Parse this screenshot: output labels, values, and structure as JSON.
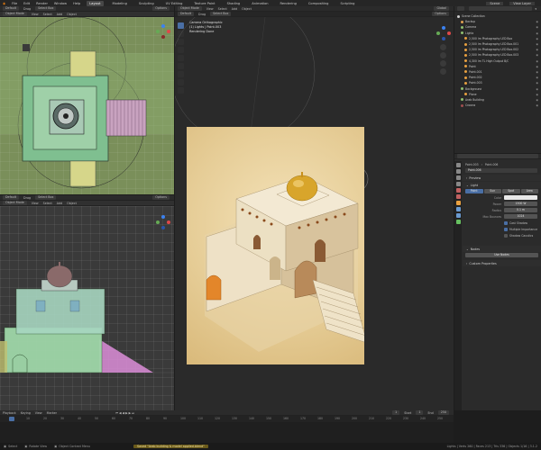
{
  "menubar": {
    "menus": [
      "File",
      "Edit",
      "Render",
      "Window",
      "Help"
    ],
    "workspaces": [
      "Layout",
      "Modeling",
      "Sculpting",
      "UV Editing",
      "Texture Paint",
      "Shading",
      "Animation",
      "Rendering",
      "Compositing",
      "Scripting"
    ],
    "active_workspace": "Layout",
    "scene_label": "Scene",
    "view_layer_label": "View Layer"
  },
  "viewport_top_left": {
    "mode": "Object Mode",
    "menus": [
      "View",
      "Select",
      "Add",
      "Object"
    ],
    "orientation": "Default",
    "drag": "Drag",
    "select": "Select Box",
    "options": "Options"
  },
  "viewport_bottom_left": {
    "mode": "Object Mode",
    "menus": [
      "View",
      "Select",
      "Add",
      "Object"
    ],
    "orientation": "Default",
    "drag": "Drag",
    "select": "Select Box",
    "options": "Options"
  },
  "viewport_main": {
    "mode": "Object Mode",
    "menus": [
      "View",
      "Select",
      "Add",
      "Object"
    ],
    "orientation": "Default",
    "drag": "Drag",
    "select": "Select Box",
    "transform": "Global",
    "options": "Options",
    "info_line1": "Camera Orthographic",
    "info_line2": "(1) Lights | Point.003",
    "info_line3": "Rendering Done"
  },
  "outliner": {
    "search_placeholder": "",
    "root": "Scene Collection",
    "items": [
      {
        "label": "Backup",
        "color": "#e0a050",
        "indent": 1
      },
      {
        "label": "Camera",
        "color": "#8fbf6f",
        "indent": 1
      },
      {
        "label": "Lights",
        "color": "#8fbf6f",
        "indent": 1
      },
      {
        "label": "2,500 lm Photography LED Box",
        "color": "#e8a040",
        "indent": 2
      },
      {
        "label": "2,500 lm Photography LED Box.001",
        "color": "#e8a040",
        "indent": 2
      },
      {
        "label": "2,500 lm Photography LED Box.002",
        "color": "#e8a040",
        "indent": 2
      },
      {
        "label": "2,500 lm Photography LED Box.003",
        "color": "#e8a040",
        "indent": 2
      },
      {
        "label": "4,300 lm TL High Output B/C",
        "color": "#e8a040",
        "indent": 2
      },
      {
        "label": "Point",
        "color": "#e8a040",
        "indent": 2
      },
      {
        "label": "Point.001",
        "color": "#e8a040",
        "indent": 2
      },
      {
        "label": "Point.002",
        "color": "#e8a040",
        "indent": 2
      },
      {
        "label": "Point.003",
        "color": "#e8a040",
        "indent": 2
      },
      {
        "label": "Background",
        "color": "#8fbf6f",
        "indent": 1
      },
      {
        "label": "Plane",
        "color": "#e8a040",
        "indent": 2
      },
      {
        "label": "Arab Building",
        "color": "#8fbf6f",
        "indent": 1
      },
      {
        "label": "Crowns",
        "color": "#a05050",
        "indent": 1
      }
    ]
  },
  "properties": {
    "object_name": "Point.003",
    "data_name": "Point.006",
    "light_name": "Point.006",
    "panels": [
      "Preview",
      "Light",
      "Nodes",
      "Custom Properties"
    ],
    "light_types": [
      "Point",
      "Sun",
      "Spot",
      "Area"
    ],
    "active_light_type": "Point",
    "fields": [
      {
        "label": "Color",
        "value": ""
      },
      {
        "label": "Power",
        "value": "1500 W"
      },
      {
        "label": "Radius",
        "value": "0.1 m"
      },
      {
        "label": "Max Bounces",
        "value": "1024"
      }
    ],
    "checkboxes": [
      "Cast Shadow",
      "Multiple Importance",
      "Shadow Caustics"
    ],
    "use_nodes": "Use Nodes"
  },
  "timeline": {
    "menus": [
      "Playback",
      "Keying",
      "View",
      "Marker"
    ],
    "current_frame": "1",
    "start_label": "Start",
    "start": "1",
    "end_label": "End",
    "end": "250",
    "ticks": [
      "0",
      "10",
      "20",
      "30",
      "40",
      "50",
      "60",
      "70",
      "80",
      "90",
      "100",
      "110",
      "120",
      "130",
      "140",
      "150",
      "160",
      "170",
      "180",
      "190",
      "200",
      "210",
      "220",
      "230",
      "240",
      "250"
    ]
  },
  "statusbar": {
    "left": "Select",
    "mid": "Rotate View",
    "right": "Object Context Menu",
    "message": "Saved \"Arab building & model applied.blend\"",
    "stats": "Lights | Verts 260 | Faces 213 | Tris 336 | Objects 1/16 | 3.1.2"
  },
  "colors": {
    "accent": "#4a6fa5",
    "render_bg": "#e7cf9a"
  }
}
